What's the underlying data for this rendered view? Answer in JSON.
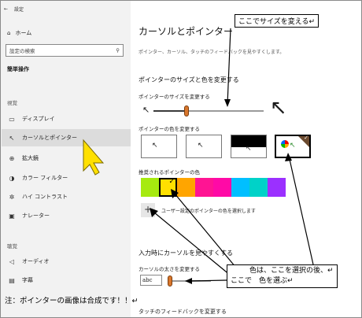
{
  "sidebar": {
    "back_label": "←",
    "title": "設定",
    "home_label": "ホーム",
    "search_placeholder": "設定の検索",
    "section_heading": "簡単操作",
    "group_vision": "視覚",
    "group_hearing": "聴覚",
    "items": [
      {
        "label": "ディスプレイ",
        "icon": "display-icon"
      },
      {
        "label": "カーソルとポインター",
        "icon": "cursor-icon"
      },
      {
        "label": "拡大鏡",
        "icon": "magnifier-icon"
      },
      {
        "label": "カラー フィルター",
        "icon": "color-filter-icon"
      },
      {
        "label": "ハイ コントラスト",
        "icon": "high-contrast-icon"
      },
      {
        "label": "ナレーター",
        "icon": "narrator-icon"
      },
      {
        "label": "オーディオ",
        "icon": "audio-icon"
      },
      {
        "label": "字幕",
        "icon": "caption-icon"
      }
    ]
  },
  "main": {
    "title": "カーソルとポインター",
    "description": "ポインター、カーソル、タッチのフィードバックを見やすくします。",
    "size_color_heading": "ポインターのサイズと色を変更する",
    "size_label": "ポインターのサイズを変更する",
    "color_label": "ポインターの色を変更する",
    "suggested_label": "推奨されるポインターの色",
    "custom_color_label": "ユーザー設定のポインターの色を選択します",
    "plus_symbol": "+",
    "cursor_visible_heading": "入力時にカーソルを見やすくする",
    "cursor_thickness_label": "カーソルの太さを変更する",
    "cursor_preview_text": "abc",
    "touch_feedback_heading": "タッチのフィードバックを変更する",
    "pointer_size_value": 0.3,
    "cursor_thickness_value": 0.05
  },
  "suggested_colors": [
    "#a6ea0f",
    "#ffe000",
    "#ffa500",
    "#ff1493",
    "#ff0aa6",
    "#00bfff",
    "#00d2c8",
    "#9b30ff"
  ],
  "annotations": {
    "callout_top": "ここでサイズを変える↵",
    "callout_bottom_line1": "色は、ここを選択の後、↵",
    "callout_bottom_line2": "ここで　色を選ぶ↵",
    "note": "注：ポインターの画像は合成です！！↵"
  },
  "colors": {
    "accent_orange": "#d9772c",
    "sidebar_bg": "#f2f2f2",
    "highlight_yellow": "#ffe000"
  }
}
